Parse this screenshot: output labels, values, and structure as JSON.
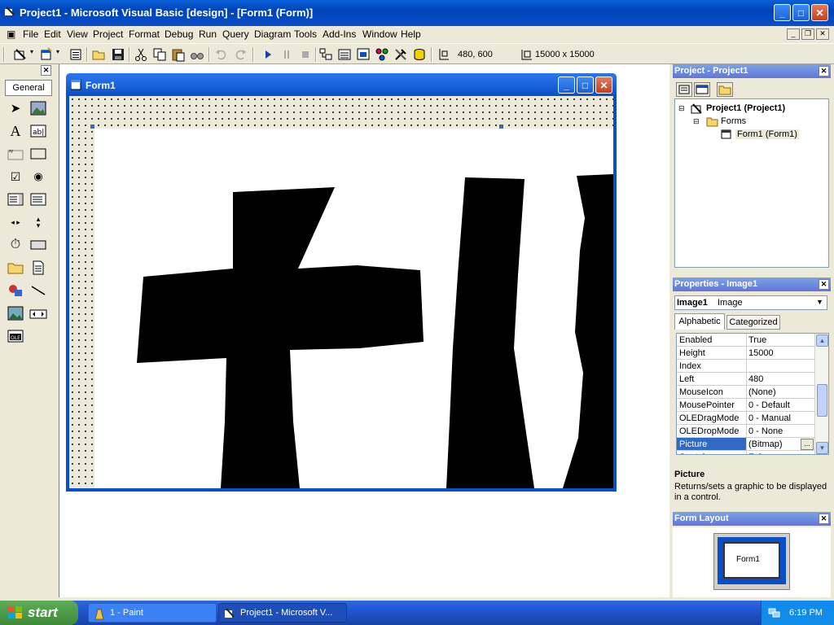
{
  "window": {
    "title": "Project1 - Microsoft Visual Basic [design] - [Form1 (Form)]"
  },
  "menu": [
    "File",
    "Edit",
    "View",
    "Project",
    "Format",
    "Debug",
    "Run",
    "Query",
    "Diagram",
    "Tools",
    "Add-Ins",
    "Window",
    "Help"
  ],
  "toolbar": {
    "position": "480, 600",
    "size": "15000 x 15000"
  },
  "toolbox": {
    "tab": "General"
  },
  "form": {
    "title": "Form1"
  },
  "project_explorer": {
    "title": "Project - Project1",
    "root": "Project1 (Project1)",
    "folder": "Forms",
    "item": "Form1 (Form1)"
  },
  "properties": {
    "title": "Properties - Image1",
    "object_name": "Image1",
    "object_type": "Image",
    "tabs": [
      "Alphabetic",
      "Categorized"
    ],
    "rows": [
      {
        "name": "Enabled",
        "value": "True"
      },
      {
        "name": "Height",
        "value": "15000"
      },
      {
        "name": "Index",
        "value": ""
      },
      {
        "name": "Left",
        "value": "480"
      },
      {
        "name": "MouseIcon",
        "value": "(None)"
      },
      {
        "name": "MousePointer",
        "value": "0 - Default"
      },
      {
        "name": "OLEDragMode",
        "value": "0 - Manual"
      },
      {
        "name": "OLEDropMode",
        "value": "0 - None"
      },
      {
        "name": "Picture",
        "value": "(Bitmap)"
      },
      {
        "name": "Stretch",
        "value": "False"
      }
    ],
    "selected": "Picture",
    "desc_title": "Picture",
    "desc_text": "Returns/sets a graphic to be displayed in a control."
  },
  "form_layout": {
    "title": "Form Layout",
    "preview_label": "Form1"
  },
  "taskbar": {
    "start": "start",
    "tasks": [
      "1 - Paint",
      "Project1 - Microsoft V..."
    ],
    "clock": "6:19 PM"
  }
}
